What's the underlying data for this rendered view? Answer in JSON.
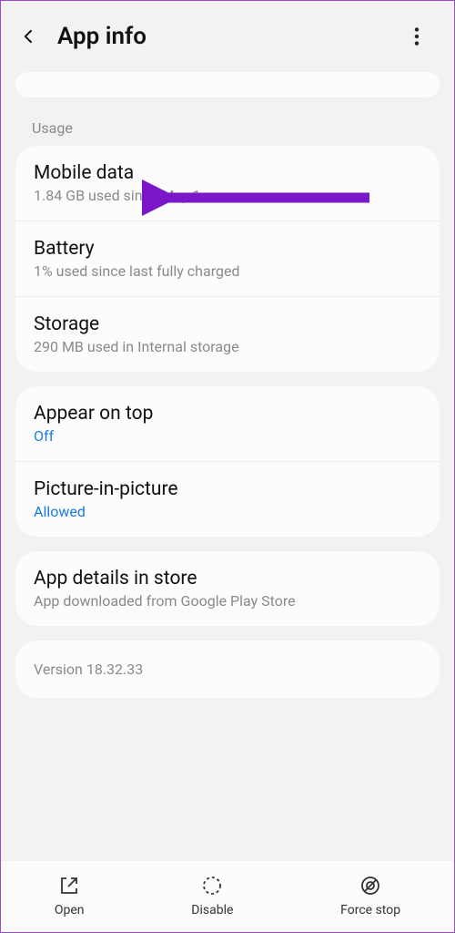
{
  "header": {
    "title": "App info"
  },
  "usage": {
    "label": "Usage",
    "mobile_data": {
      "title": "Mobile data",
      "sub": "1.84 GB used since May 1"
    },
    "battery": {
      "title": "Battery",
      "sub": "1% used since last fully charged"
    },
    "storage": {
      "title": "Storage",
      "sub": "290 MB used in Internal storage"
    }
  },
  "overlay": {
    "appear_on_top": {
      "title": "Appear on top",
      "status": "Off"
    },
    "pip": {
      "title": "Picture-in-picture",
      "status": "Allowed"
    }
  },
  "store": {
    "title": "App details in store",
    "sub": "App downloaded from Google Play Store"
  },
  "version": "Version 18.32.33",
  "bottom": {
    "open": "Open",
    "disable": "Disable",
    "force_stop": "Force stop"
  },
  "colors": {
    "accent_arrow": "#7a17c9"
  }
}
